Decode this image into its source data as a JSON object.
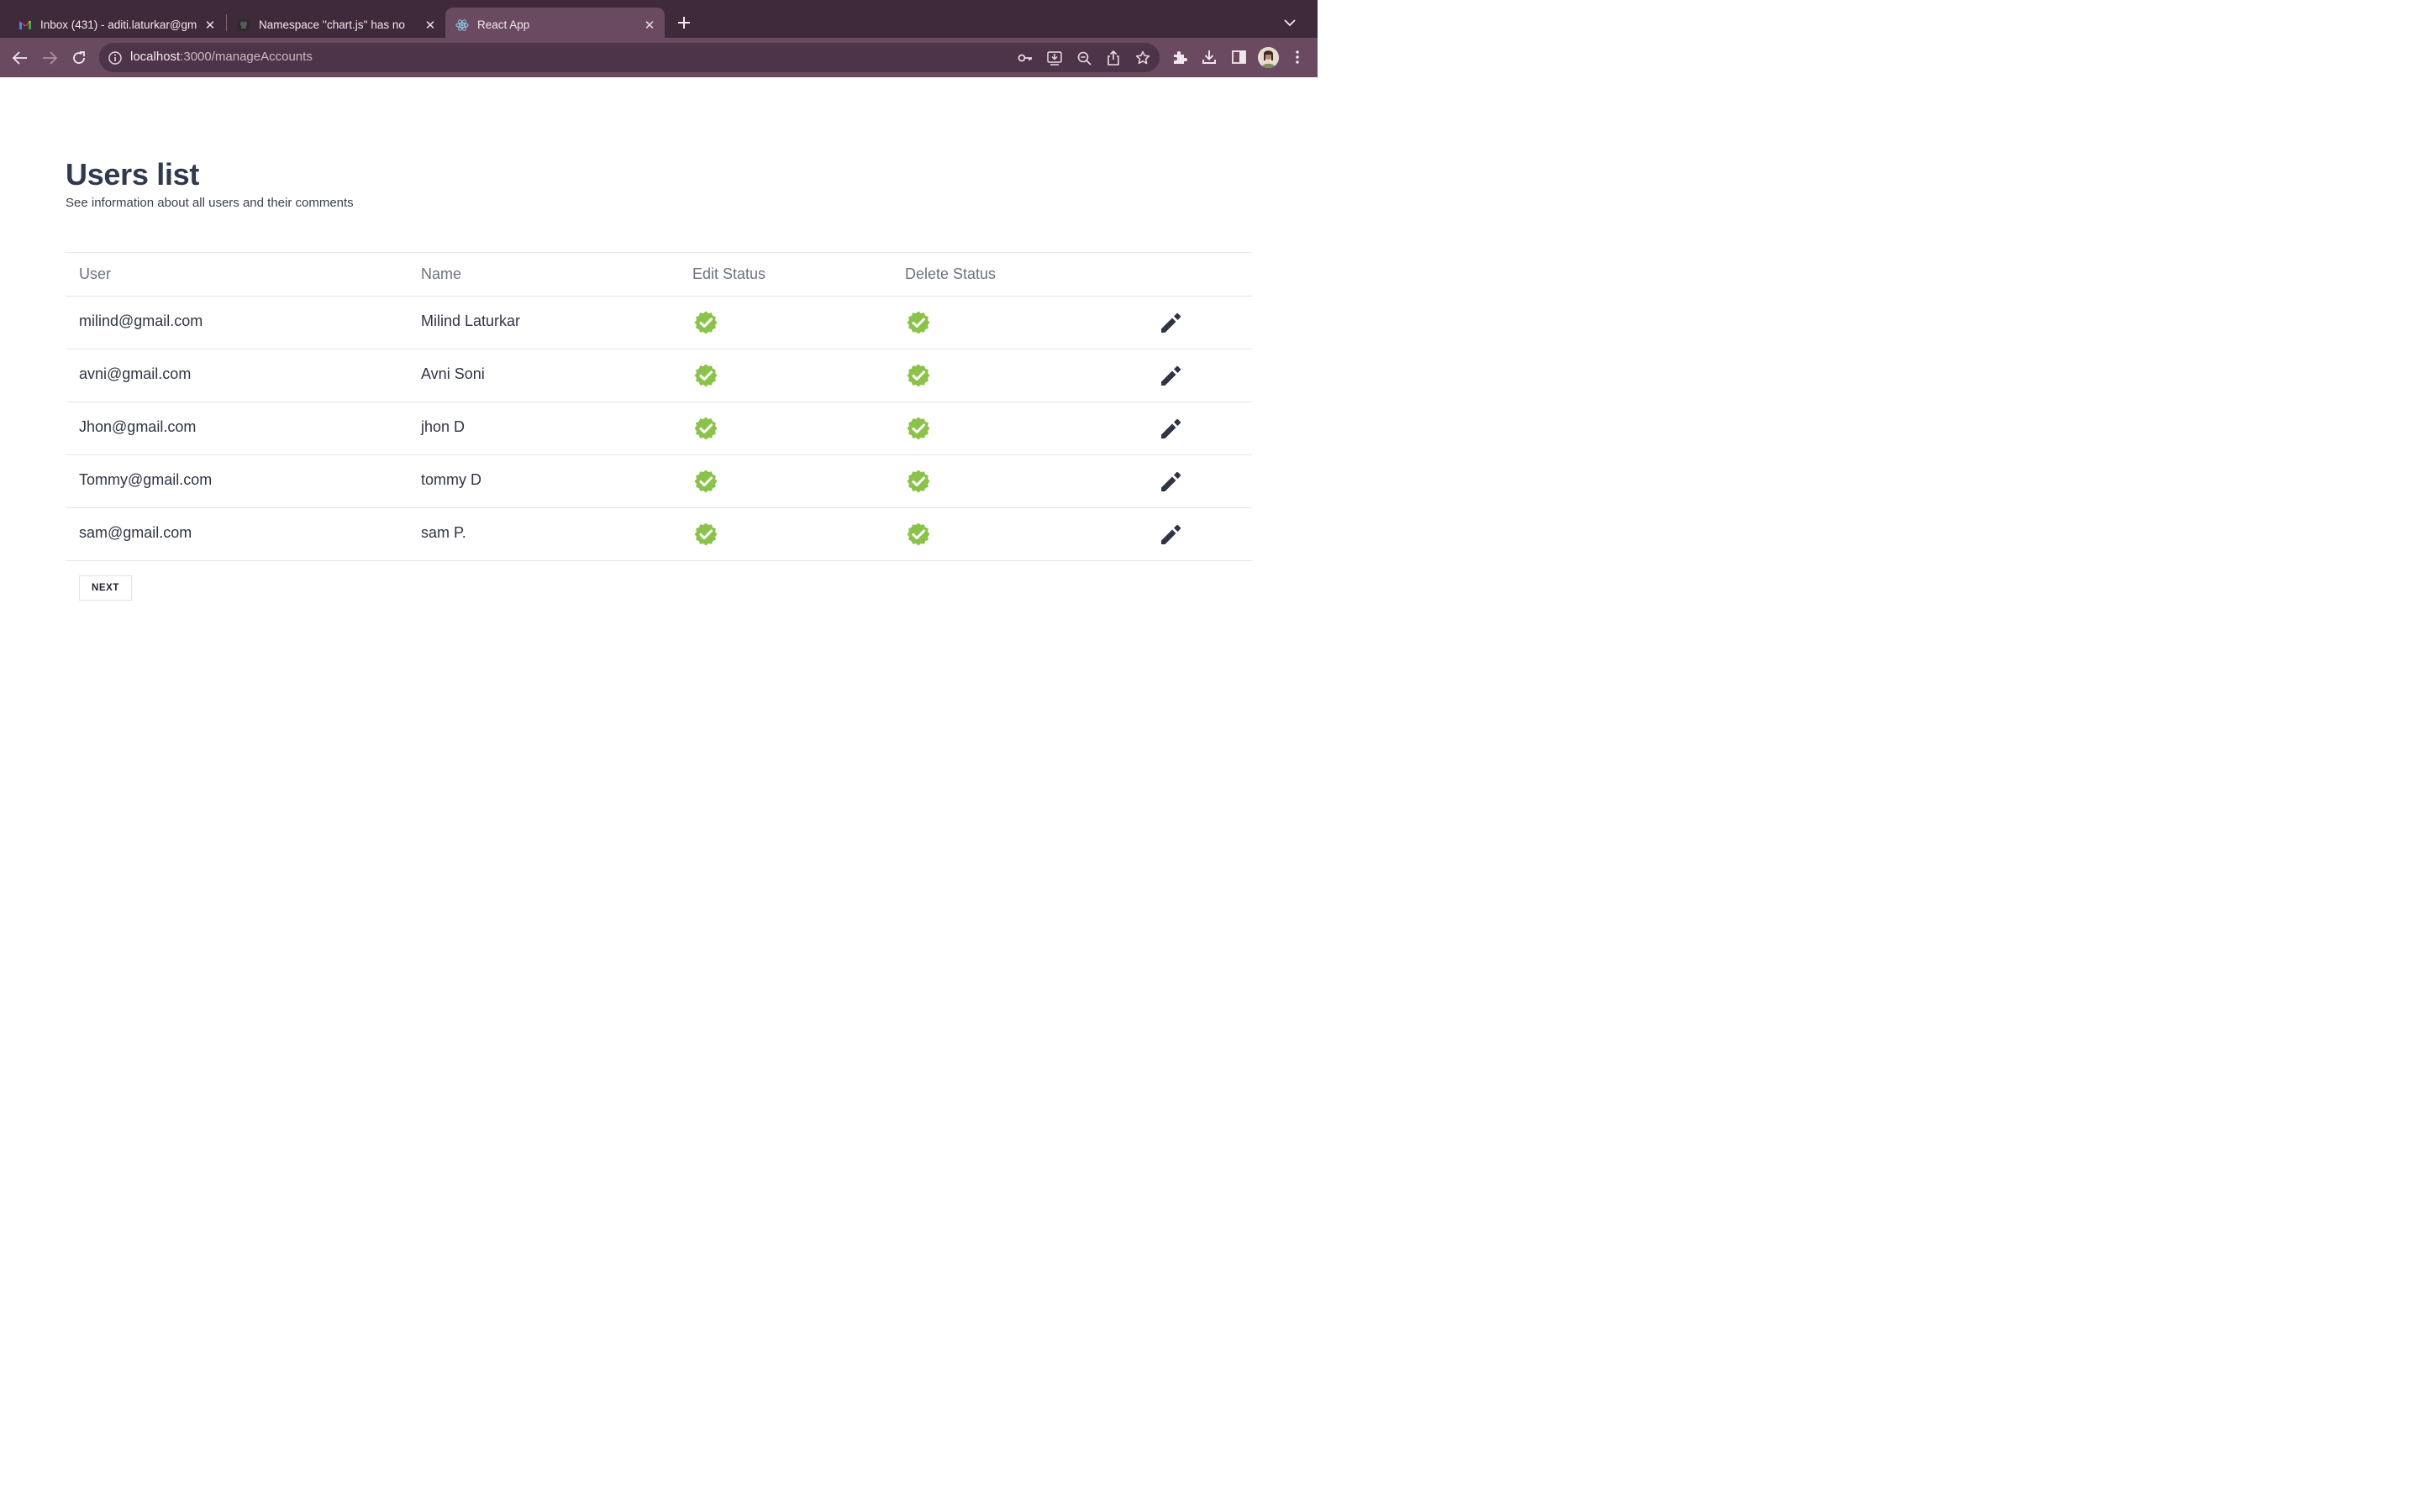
{
  "browser": {
    "tabs": [
      {
        "title": "Inbox (431) - aditi.laturkar@gm",
        "icon": "gmail-icon",
        "active": false
      },
      {
        "title": "Namespace ''chart.js'' has no",
        "icon": "github-icon",
        "active": false
      },
      {
        "title": "React App",
        "icon": "react-icon",
        "active": true
      }
    ],
    "url_host": "localhost",
    "url_path": ":3000/manageAccounts",
    "accent": "#3f2a3b",
    "toolbar_color": "#6a4a61"
  },
  "page": {
    "title": "Users list",
    "subtitle": "See information about all users and their comments"
  },
  "table": {
    "headers": [
      "User",
      "Name",
      "Edit Status",
      "Delete Status"
    ],
    "rows": [
      {
        "user": "milind@gmail.com",
        "name": "Milind Laturkar",
        "edit_status": "verified",
        "delete_status": "verified"
      },
      {
        "user": "avni@gmail.com",
        "name": "Avni Soni",
        "edit_status": "verified",
        "delete_status": "verified"
      },
      {
        "user": "Jhon@gmail.com",
        "name": "jhon D",
        "edit_status": "verified",
        "delete_status": "verified"
      },
      {
        "user": "Tommy@gmail.com",
        "name": "tommy D",
        "edit_status": "verified",
        "delete_status": "verified"
      },
      {
        "user": "sam@gmail.com",
        "name": "sam P.",
        "edit_status": "verified",
        "delete_status": "verified"
      }
    ],
    "status_color": "#8bc34a"
  },
  "pagination": {
    "next_label": "NEXT"
  }
}
